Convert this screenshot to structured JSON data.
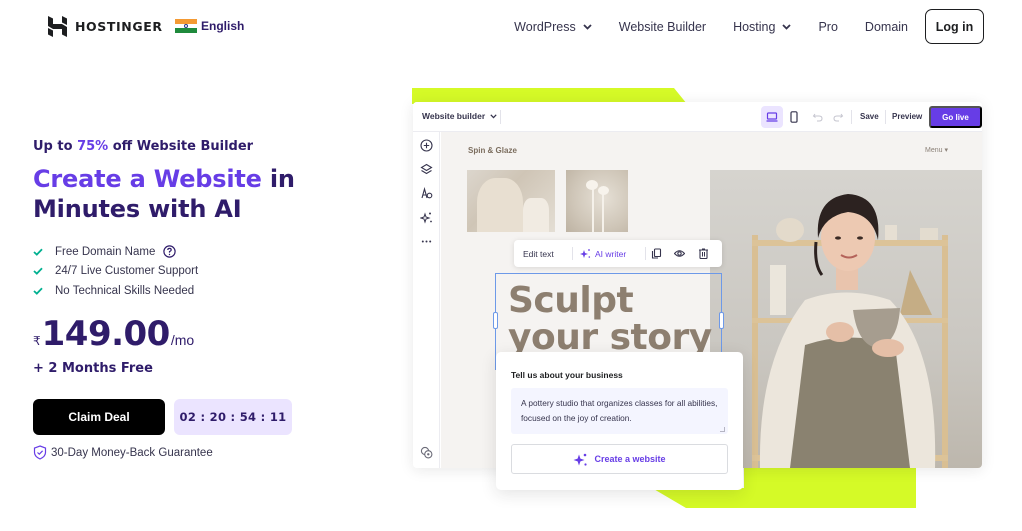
{
  "header": {
    "brand": "HOSTINGER",
    "language": "English",
    "nav": [
      {
        "label": "WordPress",
        "has_dropdown": true
      },
      {
        "label": "Website Builder",
        "has_dropdown": false
      },
      {
        "label": "Hosting",
        "has_dropdown": true
      },
      {
        "label": "Pro",
        "has_dropdown": false
      },
      {
        "label": "Domain",
        "has_dropdown": false
      }
    ],
    "login_label": "Log in"
  },
  "hero": {
    "promo_prefix": "Up to ",
    "promo_discount": "75%",
    "promo_suffix": " off Website Builder",
    "title_accent": "Create a Website",
    "title_rest_1": " in",
    "title_rest_2": "Minutes with AI",
    "features": [
      {
        "label": "Free Domain Name",
        "has_help": true
      },
      {
        "label": "24/7 Live Customer Support",
        "has_help": false
      },
      {
        "label": "No Technical Skills Needed",
        "has_help": false
      }
    ],
    "currency_symbol": "₹",
    "price": "149.00",
    "period": "/mo",
    "bonus": "+ 2 Months Free",
    "cta_label": "Claim Deal",
    "countdown": "02 : 20 : 54 : 11",
    "guarantee": "30-Day Money-Back Guarantee"
  },
  "builder": {
    "title": "Website builder",
    "save_label": "Save",
    "preview_label": "Preview",
    "golive_label": "Go live",
    "active_device": "desktop",
    "sidebar_icons": [
      "add-icon",
      "layers-icon",
      "theme-icon",
      "ai-sparkle-icon",
      "more-icon"
    ],
    "bottom_icon": "help-chat-icon",
    "site": {
      "name": "Spin & Glaze",
      "menu_label": "Menu ▾",
      "headline_1": "Sculpt",
      "headline_2": "your story"
    },
    "edit_toolbar": {
      "edit_text": "Edit text",
      "ai_writer": "AI writer"
    }
  },
  "business_card": {
    "title": "Tell us about your business",
    "description": "A pottery studio that organizes classes for all abilities, focused on the joy of creation.",
    "button_label": "Create a website"
  },
  "colors": {
    "brand_purple": "#673de6",
    "dark_navy": "#2f1c6a",
    "lime": "#d5fa27",
    "timer_bg": "#ebe4ff",
    "check_green": "#00b090"
  }
}
